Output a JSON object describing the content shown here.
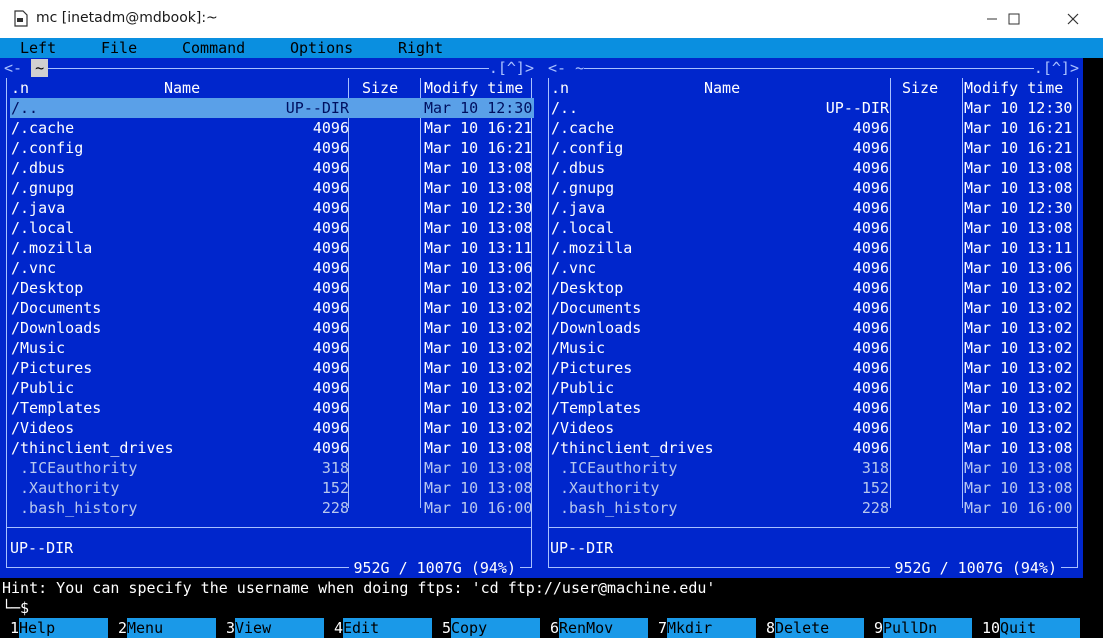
{
  "window": {
    "title": "mc [inetadm@mdbook]:~"
  },
  "menubar": [
    "Left",
    "File",
    "Command",
    "Options",
    "Right"
  ],
  "left_panel": {
    "path_prefix": "<- ",
    "path_active": "~",
    "path_suffix": ".[^]>",
    "headers": {
      "name_prefix": ".n",
      "name": "Name",
      "size": "Size",
      "modify": "Modify time"
    },
    "status": "UP--DIR",
    "free_space": "952G / 1007G (94%)"
  },
  "right_panel": {
    "path_prefix": "<- ~",
    "path_suffix": ".[^]>",
    "headers": {
      "name_prefix": ".n",
      "name": "Name",
      "size": "Size",
      "modify": "Modify time"
    },
    "status": "UP--DIR",
    "free_space": "952G / 1007G (94%)"
  },
  "files": [
    {
      "name": "/..",
      "size": "UP--DIR",
      "modified": "Mar 10 12:30",
      "is_dir": true
    },
    {
      "name": "/.cache",
      "size": "4096",
      "modified": "Mar 10 16:21",
      "is_dir": true
    },
    {
      "name": "/.config",
      "size": "4096",
      "modified": "Mar 10 16:21",
      "is_dir": true
    },
    {
      "name": "/.dbus",
      "size": "4096",
      "modified": "Mar 10 13:08",
      "is_dir": true
    },
    {
      "name": "/.gnupg",
      "size": "4096",
      "modified": "Mar 10 13:08",
      "is_dir": true
    },
    {
      "name": "/.java",
      "size": "4096",
      "modified": "Mar 10 12:30",
      "is_dir": true
    },
    {
      "name": "/.local",
      "size": "4096",
      "modified": "Mar 10 13:08",
      "is_dir": true
    },
    {
      "name": "/.mozilla",
      "size": "4096",
      "modified": "Mar 10 13:11",
      "is_dir": true
    },
    {
      "name": "/.vnc",
      "size": "4096",
      "modified": "Mar 10 13:06",
      "is_dir": true
    },
    {
      "name": "/Desktop",
      "size": "4096",
      "modified": "Mar 10 13:02",
      "is_dir": true
    },
    {
      "name": "/Documents",
      "size": "4096",
      "modified": "Mar 10 13:02",
      "is_dir": true
    },
    {
      "name": "/Downloads",
      "size": "4096",
      "modified": "Mar 10 13:02",
      "is_dir": true
    },
    {
      "name": "/Music",
      "size": "4096",
      "modified": "Mar 10 13:02",
      "is_dir": true
    },
    {
      "name": "/Pictures",
      "size": "4096",
      "modified": "Mar 10 13:02",
      "is_dir": true
    },
    {
      "name": "/Public",
      "size": "4096",
      "modified": "Mar 10 13:02",
      "is_dir": true
    },
    {
      "name": "/Templates",
      "size": "4096",
      "modified": "Mar 10 13:02",
      "is_dir": true
    },
    {
      "name": "/Videos",
      "size": "4096",
      "modified": "Mar 10 13:02",
      "is_dir": true
    },
    {
      "name": "/thinclient_drives",
      "size": "4096",
      "modified": "Mar 10 13:08",
      "is_dir": true
    },
    {
      "name": " .ICEauthority",
      "size": "318",
      "modified": "Mar 10 13:08",
      "is_dir": false
    },
    {
      "name": " .Xauthority",
      "size": "152",
      "modified": "Mar 10 13:08",
      "is_dir": false
    },
    {
      "name": " .bash_history",
      "size": "228",
      "modified": "Mar 10 16:00",
      "is_dir": false
    }
  ],
  "hint": "Hint: You can specify the username when doing ftps: 'cd ftp://user@machine.edu'",
  "prompt": "└─$",
  "fkeys": [
    {
      "num": "1",
      "label": "Help"
    },
    {
      "num": "2",
      "label": "Menu"
    },
    {
      "num": "3",
      "label": "View"
    },
    {
      "num": "4",
      "label": "Edit"
    },
    {
      "num": "5",
      "label": "Copy"
    },
    {
      "num": "6",
      "label": "RenMov"
    },
    {
      "num": "7",
      "label": "Mkdir"
    },
    {
      "num": "8",
      "label": "Delete"
    },
    {
      "num": "9",
      "label": "PullDn"
    },
    {
      "num": "10",
      "label": "Quit"
    }
  ]
}
